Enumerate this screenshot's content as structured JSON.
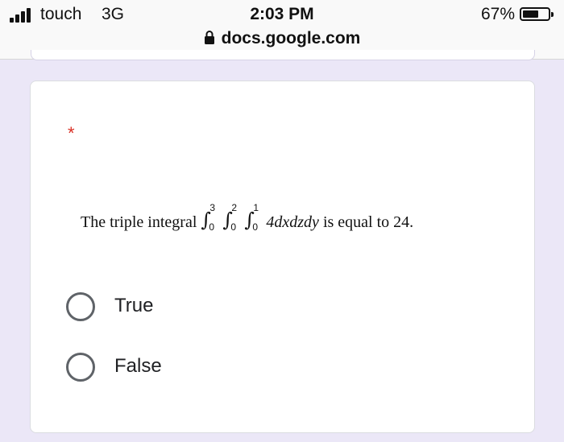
{
  "status_bar": {
    "carrier": "touch",
    "network": "3G",
    "time": "2:03 PM",
    "battery_percent": "67%",
    "battery_level": 0.67,
    "signal_bars": 4,
    "icons": [
      "signal-bars-icon",
      "battery-icon",
      "lock-icon"
    ]
  },
  "address_bar": {
    "url": "docs.google.com"
  },
  "question": {
    "required_marker": "*",
    "prefix": "The triple integral ",
    "integrals": [
      {
        "upper": "3",
        "lower": "0"
      },
      {
        "upper": "2",
        "lower": "0"
      },
      {
        "upper": "1",
        "lower": "0"
      }
    ],
    "integrand": "4dxdzdy",
    "suffix": " is equal to 24.",
    "options": [
      {
        "label": "True",
        "selected": false
      },
      {
        "label": "False",
        "selected": false
      }
    ]
  }
}
